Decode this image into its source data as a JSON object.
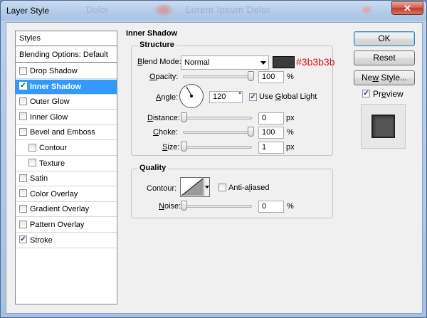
{
  "window": {
    "title": "Layer Style",
    "background_title_ghost": "Lorem Ipsum Dolor",
    "background_title_ghost_left": "Dolor"
  },
  "styles_list": {
    "header": "Styles",
    "blending_options": "Blending Options: Default",
    "items": [
      {
        "label": "Drop Shadow",
        "checked": false
      },
      {
        "label": "Inner Shadow",
        "checked": true,
        "selected": true
      },
      {
        "label": "Outer Glow",
        "checked": false
      },
      {
        "label": "Inner Glow",
        "checked": false
      },
      {
        "label": "Bevel and Emboss",
        "checked": false
      },
      {
        "label": "Contour",
        "checked": false,
        "sub": true
      },
      {
        "label": "Texture",
        "checked": false,
        "sub": true
      },
      {
        "label": "Satin",
        "checked": false
      },
      {
        "label": "Color Overlay",
        "checked": false
      },
      {
        "label": "Gradient Overlay",
        "checked": false
      },
      {
        "label": "Pattern Overlay",
        "checked": false
      },
      {
        "label": "Stroke",
        "checked": true
      }
    ]
  },
  "inner_shadow": {
    "section_title": "Inner Shadow",
    "structure_title": "Structure",
    "blend_mode_label": "Blend Mode:",
    "blend_mode_value": "Normal",
    "color": "#3b3b3b",
    "color_note": "#3b3b3b",
    "opacity_label": "Opacity:",
    "opacity_value": "100",
    "opacity_unit": "%",
    "opacity_fraction": 1.0,
    "angle_label": "Angle:",
    "angle_value": "120",
    "angle_unit": "°",
    "use_global_light_label": "Use Global Light",
    "use_global_light_checked": true,
    "distance_label": "Distance:",
    "distance_value": "0",
    "distance_unit": "px",
    "distance_fraction": 0.0,
    "choke_label": "Choke:",
    "choke_value": "100",
    "choke_unit": "%",
    "choke_fraction": 1.0,
    "size_label": "Size:",
    "size_value": "1",
    "size_unit": "px",
    "size_fraction": 0.0
  },
  "quality": {
    "title": "Quality",
    "contour_label": "Contour:",
    "anti_aliased_label": "Anti-aliased",
    "anti_aliased_checked": false,
    "noise_label": "Noise:",
    "noise_value": "0",
    "noise_unit": "%",
    "noise_fraction": 0.0
  },
  "buttons": {
    "ok": "OK",
    "reset": "Reset",
    "new_style": "New Style...",
    "preview_label": "Preview",
    "preview_checked": true
  },
  "colors": {
    "selection": "#3399ff",
    "note": "#e01010"
  }
}
